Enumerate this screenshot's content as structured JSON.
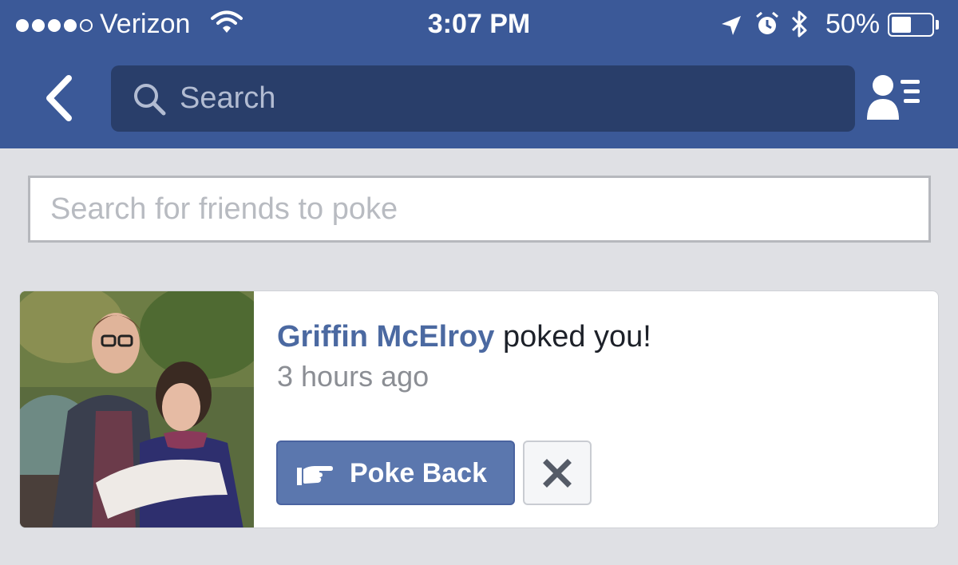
{
  "status_bar": {
    "carrier": "Verizon",
    "time": "3:07 PM",
    "battery_percent": "50%",
    "battery_level": 0.5,
    "signal_bars_filled": 4,
    "signal_bars_total": 5
  },
  "nav": {
    "search_placeholder": "Search",
    "back_icon": "chevron-left-icon",
    "friend_requests_icon": "friend-requests-icon"
  },
  "poke_search": {
    "placeholder": "Search for friends to poke"
  },
  "poke_card": {
    "name": "Griffin McElroy",
    "action": "poked you!",
    "time_ago": "3 hours ago",
    "poke_back_label": "Poke Back",
    "poke_back_icon": "pointing-hand-icon",
    "dismiss_icon": "close-icon"
  },
  "colors": {
    "brand_blue": "#3b5998",
    "search_bar": "#293e6a",
    "button_blue": "#5b77ae",
    "name_link": "#4b69a1",
    "page_bg": "#dfe0e4"
  }
}
